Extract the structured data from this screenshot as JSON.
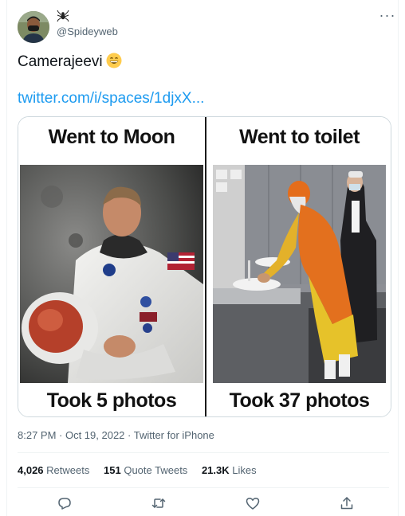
{
  "tweet": {
    "author_name_icon": "spider-icon",
    "handle": "@Spideyweb",
    "text": "Camerajeevi",
    "emoji": "grinning-face-emoji",
    "link": "twitter.com/i/spaces/1djxX...",
    "media": {
      "left_top": "Went to Moon",
      "left_bottom": "Took 5 photos",
      "right_top": "Went to toilet",
      "right_bottom": "Took 37 photos"
    },
    "timestamp": "8:27 PM · Oct 19, 2022 · Twitter for iPhone",
    "stats": {
      "retweets_count": "4,026",
      "retweets_label": "Retweets",
      "quotes_count": "151",
      "quotes_label": "Quote Tweets",
      "likes_count": "21.3K",
      "likes_label": "Likes"
    },
    "actions": [
      "reply-icon",
      "retweet-icon",
      "like-icon",
      "share-icon"
    ],
    "colors": {
      "link": "#1d9bf0",
      "secondary_text": "#536471",
      "border": "#cfd9de"
    }
  }
}
